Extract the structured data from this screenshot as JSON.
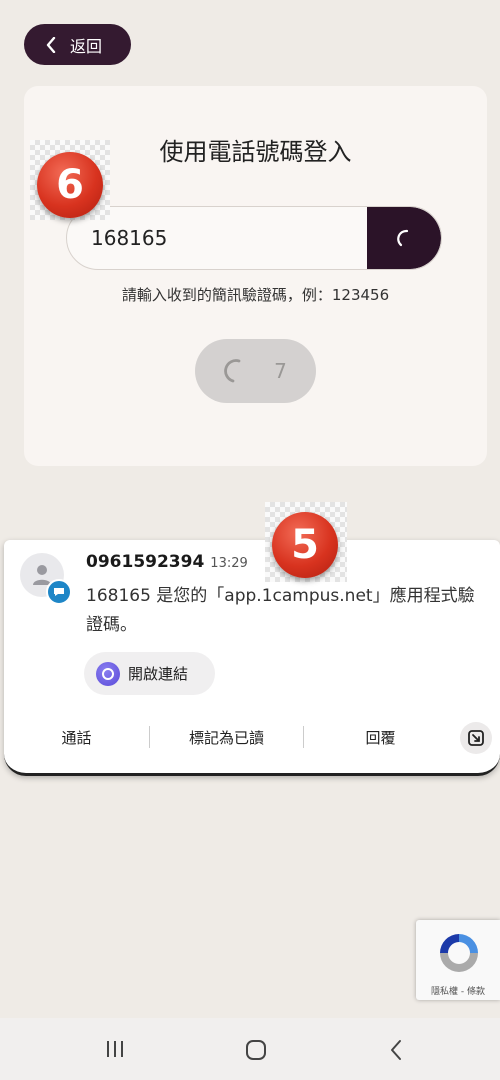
{
  "header": {
    "back_label": "返回"
  },
  "login_card": {
    "title": "使用電話號碼登入",
    "code_value": "168165",
    "hint": "請輸入收到的簡訊驗證碼，例：123456",
    "resend_countdown": "7"
  },
  "step_badges": {
    "step_6": "6",
    "step_5": "5"
  },
  "notification": {
    "sender": "0961592394",
    "time": "13:29",
    "message": "168165 是您的「app.1campus.net」應用程式驗證碼。",
    "open_link_label": "開啟連結",
    "actions": {
      "call": "通話",
      "mark_read": "標記為已讀",
      "reply": "回覆"
    }
  },
  "recaptcha": {
    "links": "隱私權 - 條款"
  },
  "colors": {
    "accent": "#341a30",
    "badge_red": "#d8331f",
    "background": "#efebe6"
  }
}
